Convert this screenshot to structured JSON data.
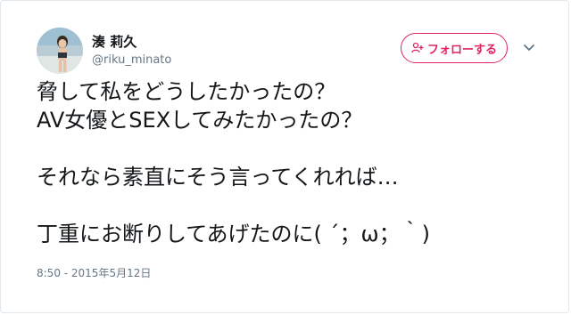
{
  "user": {
    "display_name": "湊 莉久",
    "handle": "@riku_minato"
  },
  "follow_button": {
    "label": "フォローする"
  },
  "tweet": {
    "lines": [
      "脅して私をどうしたかったの？",
      "AV女優とSEXしてみたかったの？",
      "",
      "それなら素直にそう言ってくれれば…",
      "",
      "丁重にお断りしてあげたのに( ´；ω；｀)"
    ],
    "timestamp": "8:50 - 2015年5月12日"
  },
  "colors": {
    "accent": "#e0245e",
    "text": "#14171a",
    "secondary": "#657786",
    "border": "#e1e8ed"
  },
  "icons": {
    "follow": "person-plus-icon",
    "menu": "chevron-down-icon"
  }
}
